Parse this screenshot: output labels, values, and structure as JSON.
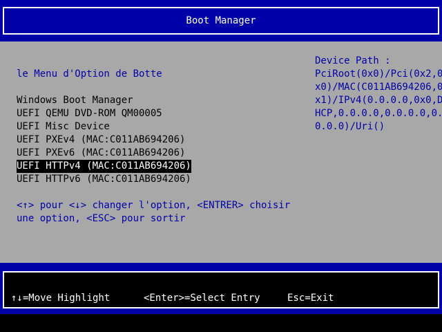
{
  "title": "Boot Manager",
  "section_title": "le Menu d'Option de Botte",
  "boot_options": [
    {
      "label": "Windows Boot Manager",
      "selected": false
    },
    {
      "label": "UEFI QEMU DVD-ROM QM00005",
      "selected": false
    },
    {
      "label": "UEFI Misc Device",
      "selected": false
    },
    {
      "label": "UEFI PXEv4 (MAC:C011AB694206)",
      "selected": false
    },
    {
      "label": "UEFI PXEv6 (MAC:C011AB694206)",
      "selected": false
    },
    {
      "label": "UEFI HTTPv4 (MAC:C011AB694206)",
      "selected": true
    },
    {
      "label": "UEFI HTTPv6 (MAC:C011AB694206)",
      "selected": false
    }
  ],
  "hint_text": "<↑> pour <↓> changer l'option, <ENTRER> choisir une option, <ESC> pour sortir",
  "device_path": {
    "heading": "Device Path :",
    "lines": [
      "PciRoot(0x0)/Pci(0x2,0",
      "x0)/MAC(C011AB694206,0",
      "x1)/IPv4(0.0.0.0,0x0,D",
      "HCP,0.0.0.0,0.0.0.0,0.",
      "0.0.0)/Uri()"
    ]
  },
  "help_bar": {
    "move": "↑↓=Move Highlight",
    "select": "<Enter>=Select Entry",
    "exit": "Esc=Exit"
  },
  "colors": {
    "blue": "#0000a8",
    "grey": "#a8a8a8",
    "white": "#ffffff",
    "black": "#000000"
  }
}
